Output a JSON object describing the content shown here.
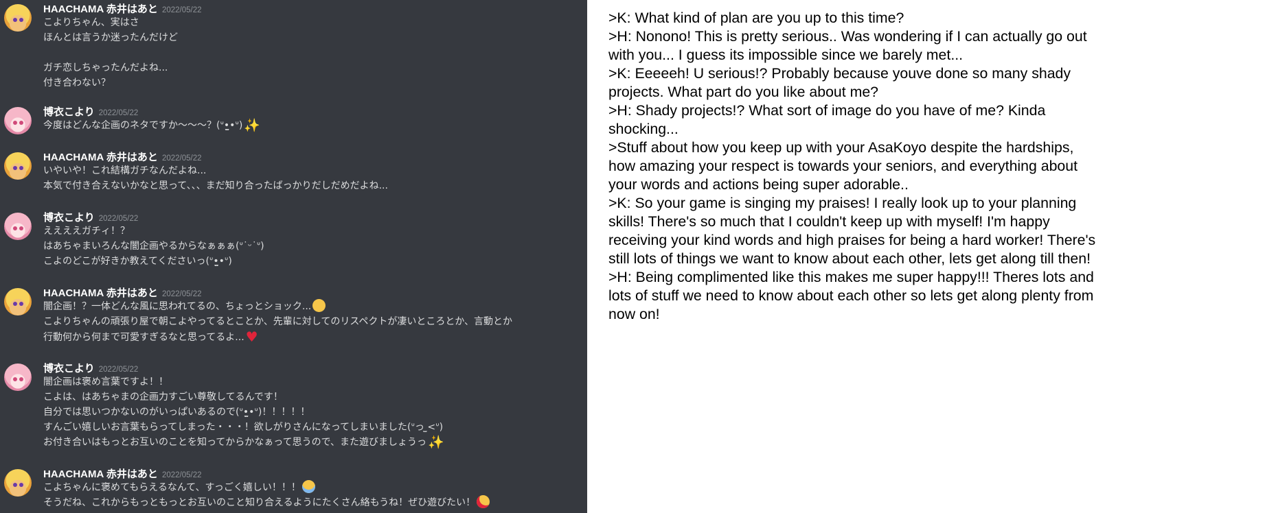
{
  "chat": {
    "messages": [
      {
        "author": "HAACHAMA 赤井はあと",
        "timestamp": "2022/05/22",
        "avatar": "haachama-avatar",
        "lines": [
          {
            "text": "こよりちゃん、実はさ"
          },
          {
            "text": "ほんとは言うか迷ったんだけど"
          },
          {
            "text": ""
          },
          {
            "text": "ガチ恋しちゃったんだよね..."
          },
          {
            "text": "付き合わない？"
          }
        ]
      },
      {
        "author": "博衣こより",
        "timestamp": "2022/05/22",
        "avatar": "koyori-avatar",
        "lines": [
          {
            "text": "今度はどんな企画のネタですか～～～？(ᐡ•̤̫•ᐡ)",
            "emoji": "sparkles-emoji"
          }
        ]
      },
      {
        "author": "HAACHAMA 赤井はあと",
        "timestamp": "2022/05/22",
        "avatar": "haachama-avatar",
        "lines": [
          {
            "text": "いやいや！これ結構ガチなんだよね..."
          },
          {
            "text": "本気で付き合えないかなと思って、、、まだ知り合ったばっかりだしだめだよね..."
          }
        ]
      },
      {
        "author": "博衣こより",
        "timestamp": "2022/05/22",
        "avatar": "koyori-avatar",
        "lines": [
          {
            "text": "ええええガチィ！？"
          },
          {
            "text": "はあちゃまいろんな闇企画やるからなぁぁぁ(ᐡ˙ᵕ˙ᐡ)"
          },
          {
            "text": "こよのどこが好きか教えてくださいっ(ᐡ•̤̫•ᐡ)"
          }
        ]
      },
      {
        "author": "HAACHAMA 赤井はあと",
        "timestamp": "2022/05/22",
        "avatar": "haachama-avatar",
        "lines": [
          {
            "text": "闇企画！？一体どんな風に思われてるの、ちょっとショック...",
            "emoji": "face-emoji"
          },
          {
            "text": "こよりちゃんの頑張り屋で朝こよやってるとことか、先輩に対してのリスペクトが凄いところとか、言動とか"
          },
          {
            "text": "行動何から何まで可愛すぎるなと思ってるよ...",
            "emoji": "heart-emoji"
          }
        ]
      },
      {
        "author": "博衣こより",
        "timestamp": "2022/05/22",
        "avatar": "koyori-avatar",
        "lines": [
          {
            "text": "闇企画は褒め言葉ですよ！！"
          },
          {
            "text": "こよは、はあちゃまの企画力すごい尊敬してるんです！"
          },
          {
            "text": "自分では思いつかないのがいっぱいあるので(ᐡ•̤̫•ᐡ)！！！！！"
          },
          {
            "text": "すんごい嬉しいお言葉もらってしまった・・・！欲しがりさんになってしまいました(ᐡっ ̫<ᐡ)"
          },
          {
            "text": "お付き合いはもっとお互いのことを知ってからかなぁって思うので、また遊びましょうっ",
            "emoji": "sparkles-emoji"
          }
        ]
      },
      {
        "author": "HAACHAMA 赤井はあと",
        "timestamp": "2022/05/22",
        "avatar": "haachama-avatar",
        "lines": [
          {
            "text": "こよちゃんに褒めてもらえるなんて、すっごく嬉しい！！！",
            "emoji": "crying-face-emoji"
          },
          {
            "text": "そうだね、これからもっともっとお互いのこと知り合えるようにたくさん絡もうね！ぜひ遊びたい！",
            "emoji": "smiling-face-with-hearts-emoji"
          }
        ]
      }
    ]
  },
  "translation": {
    "lines": [
      ">K: What kind of plan are you up to this time?",
      ">H: Nonono! This is pretty serious.. Was wondering if I can actually go out",
      "with you... I guess its impossible since we barely met...",
      ">K: Eeeeeh! U serious!? Probably because youve done so many shady",
      "projects. What part do you like about me?",
      ">H: Shady projects!? What sort of image do you have of me? Kinda",
      "shocking...",
      ">Stuff about how you keep up with your AsaKoyo despite the hardships,",
      "how amazing your respect is towards your seniors, and everything about",
      "your words and actions being super adorable..",
      ">K: So your game is singing my praises! I really look up to your planning",
      "skills! There's so much that I couldn't keep up with myself! I'm happy",
      "receiving your kind words and high praises for being a hard worker! There's",
      "still lots of things we want to know about each other, lets get along till then!",
      ">H: Being complimented like this makes me super happy!!! Theres lots and",
      "lots of stuff we need to know about each other so lets get along plenty from",
      "now on!"
    ]
  }
}
